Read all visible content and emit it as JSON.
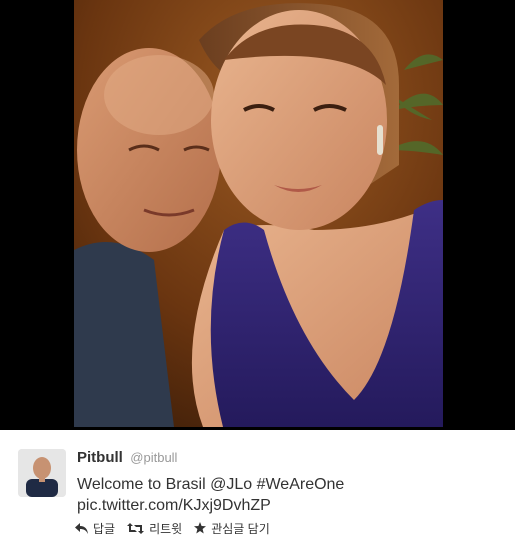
{
  "tweet": {
    "fullname": "Pitbull",
    "username": "@pitbull",
    "text": {
      "prefix": "Welcome to Brasil ",
      "mention": "@JLo",
      "space": " ",
      "hashtag": "#WeAreOne",
      "link": "pic.twitter.com/KJxj9DvhZP"
    },
    "actions": {
      "reply": "답글",
      "retweet": "리트윗",
      "favorite": "관심글 담기"
    }
  },
  "icons": {
    "reply": "reply-icon",
    "retweet": "retweet-icon",
    "favorite": "star-icon"
  },
  "colors": {
    "media_background": "#000000",
    "text": "#333333",
    "username": "#999999"
  }
}
